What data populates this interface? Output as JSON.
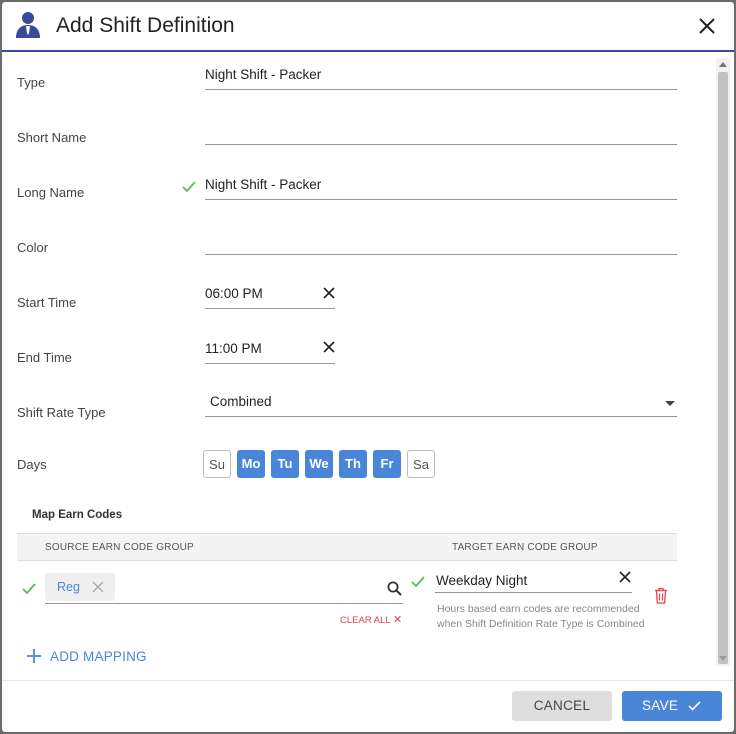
{
  "dialog": {
    "title": "Add Shift Definition"
  },
  "form": {
    "type_label": "Type",
    "type_value": "Night Shift - Packer",
    "short_name_label": "Short Name",
    "short_name_value": "",
    "long_name_label": "Long Name",
    "long_name_value": "Night Shift - Packer",
    "color_label": "Color",
    "color_value": "",
    "start_time_label": "Start Time",
    "start_time_value": "06:00 PM",
    "end_time_label": "End Time",
    "end_time_value": "11:00 PM",
    "rate_type_label": "Shift Rate Type",
    "rate_type_value": "Combined",
    "days_label": "Days",
    "days": [
      {
        "label": "Su",
        "selected": false
      },
      {
        "label": "Mo",
        "selected": true
      },
      {
        "label": "Tu",
        "selected": true
      },
      {
        "label": "We",
        "selected": true
      },
      {
        "label": "Th",
        "selected": true
      },
      {
        "label": "Fr",
        "selected": true
      },
      {
        "label": "Sa",
        "selected": false
      }
    ]
  },
  "mapping": {
    "section_title": "Map Earn Codes",
    "source_header": "SOURCE EARN CODE GROUP",
    "target_header": "TARGET EARN CODE GROUP",
    "source_chip": "Reg",
    "clear_all": "CLEAR ALL",
    "target_value": "Weekday Night",
    "hint_line1": "Hours based earn codes are recommended",
    "hint_line2": "when Shift Definition Rate Type is Combined",
    "add_mapping": "ADD MAPPING"
  },
  "footer": {
    "cancel": "CANCEL",
    "save": "SAVE"
  },
  "colors": {
    "accent": "#4a86d8",
    "header_rule": "#3d4a9c",
    "success": "#5cb85c",
    "danger": "#e0434b"
  }
}
